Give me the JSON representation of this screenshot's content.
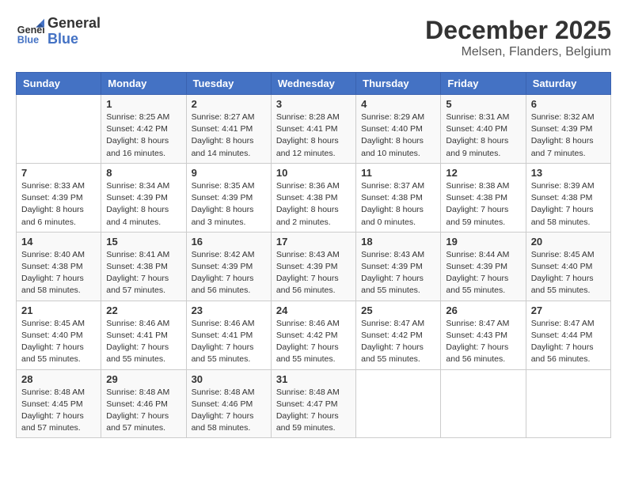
{
  "logo": {
    "line1": "General",
    "line2": "Blue"
  },
  "title": "December 2025",
  "subtitle": "Melsen, Flanders, Belgium",
  "days_of_week": [
    "Sunday",
    "Monday",
    "Tuesday",
    "Wednesday",
    "Thursday",
    "Friday",
    "Saturday"
  ],
  "weeks": [
    [
      {
        "day": "",
        "info": ""
      },
      {
        "day": "1",
        "info": "Sunrise: 8:25 AM\nSunset: 4:42 PM\nDaylight: 8 hours and 16 minutes."
      },
      {
        "day": "2",
        "info": "Sunrise: 8:27 AM\nSunset: 4:41 PM\nDaylight: 8 hours and 14 minutes."
      },
      {
        "day": "3",
        "info": "Sunrise: 8:28 AM\nSunset: 4:41 PM\nDaylight: 8 hours and 12 minutes."
      },
      {
        "day": "4",
        "info": "Sunrise: 8:29 AM\nSunset: 4:40 PM\nDaylight: 8 hours and 10 minutes."
      },
      {
        "day": "5",
        "info": "Sunrise: 8:31 AM\nSunset: 4:40 PM\nDaylight: 8 hours and 9 minutes."
      },
      {
        "day": "6",
        "info": "Sunrise: 8:32 AM\nSunset: 4:39 PM\nDaylight: 8 hours and 7 minutes."
      }
    ],
    [
      {
        "day": "7",
        "info": "Sunrise: 8:33 AM\nSunset: 4:39 PM\nDaylight: 8 hours and 6 minutes."
      },
      {
        "day": "8",
        "info": "Sunrise: 8:34 AM\nSunset: 4:39 PM\nDaylight: 8 hours and 4 minutes."
      },
      {
        "day": "9",
        "info": "Sunrise: 8:35 AM\nSunset: 4:39 PM\nDaylight: 8 hours and 3 minutes."
      },
      {
        "day": "10",
        "info": "Sunrise: 8:36 AM\nSunset: 4:38 PM\nDaylight: 8 hours and 2 minutes."
      },
      {
        "day": "11",
        "info": "Sunrise: 8:37 AM\nSunset: 4:38 PM\nDaylight: 8 hours and 0 minutes."
      },
      {
        "day": "12",
        "info": "Sunrise: 8:38 AM\nSunset: 4:38 PM\nDaylight: 7 hours and 59 minutes."
      },
      {
        "day": "13",
        "info": "Sunrise: 8:39 AM\nSunset: 4:38 PM\nDaylight: 7 hours and 58 minutes."
      }
    ],
    [
      {
        "day": "14",
        "info": "Sunrise: 8:40 AM\nSunset: 4:38 PM\nDaylight: 7 hours and 58 minutes."
      },
      {
        "day": "15",
        "info": "Sunrise: 8:41 AM\nSunset: 4:38 PM\nDaylight: 7 hours and 57 minutes."
      },
      {
        "day": "16",
        "info": "Sunrise: 8:42 AM\nSunset: 4:39 PM\nDaylight: 7 hours and 56 minutes."
      },
      {
        "day": "17",
        "info": "Sunrise: 8:43 AM\nSunset: 4:39 PM\nDaylight: 7 hours and 56 minutes."
      },
      {
        "day": "18",
        "info": "Sunrise: 8:43 AM\nSunset: 4:39 PM\nDaylight: 7 hours and 55 minutes."
      },
      {
        "day": "19",
        "info": "Sunrise: 8:44 AM\nSunset: 4:39 PM\nDaylight: 7 hours and 55 minutes."
      },
      {
        "day": "20",
        "info": "Sunrise: 8:45 AM\nSunset: 4:40 PM\nDaylight: 7 hours and 55 minutes."
      }
    ],
    [
      {
        "day": "21",
        "info": "Sunrise: 8:45 AM\nSunset: 4:40 PM\nDaylight: 7 hours and 55 minutes."
      },
      {
        "day": "22",
        "info": "Sunrise: 8:46 AM\nSunset: 4:41 PM\nDaylight: 7 hours and 55 minutes."
      },
      {
        "day": "23",
        "info": "Sunrise: 8:46 AM\nSunset: 4:41 PM\nDaylight: 7 hours and 55 minutes."
      },
      {
        "day": "24",
        "info": "Sunrise: 8:46 AM\nSunset: 4:42 PM\nDaylight: 7 hours and 55 minutes."
      },
      {
        "day": "25",
        "info": "Sunrise: 8:47 AM\nSunset: 4:42 PM\nDaylight: 7 hours and 55 minutes."
      },
      {
        "day": "26",
        "info": "Sunrise: 8:47 AM\nSunset: 4:43 PM\nDaylight: 7 hours and 56 minutes."
      },
      {
        "day": "27",
        "info": "Sunrise: 8:47 AM\nSunset: 4:44 PM\nDaylight: 7 hours and 56 minutes."
      }
    ],
    [
      {
        "day": "28",
        "info": "Sunrise: 8:48 AM\nSunset: 4:45 PM\nDaylight: 7 hours and 57 minutes."
      },
      {
        "day": "29",
        "info": "Sunrise: 8:48 AM\nSunset: 4:46 PM\nDaylight: 7 hours and 57 minutes."
      },
      {
        "day": "30",
        "info": "Sunrise: 8:48 AM\nSunset: 4:46 PM\nDaylight: 7 hours and 58 minutes."
      },
      {
        "day": "31",
        "info": "Sunrise: 8:48 AM\nSunset: 4:47 PM\nDaylight: 7 hours and 59 minutes."
      },
      {
        "day": "",
        "info": ""
      },
      {
        "day": "",
        "info": ""
      },
      {
        "day": "",
        "info": ""
      }
    ]
  ]
}
